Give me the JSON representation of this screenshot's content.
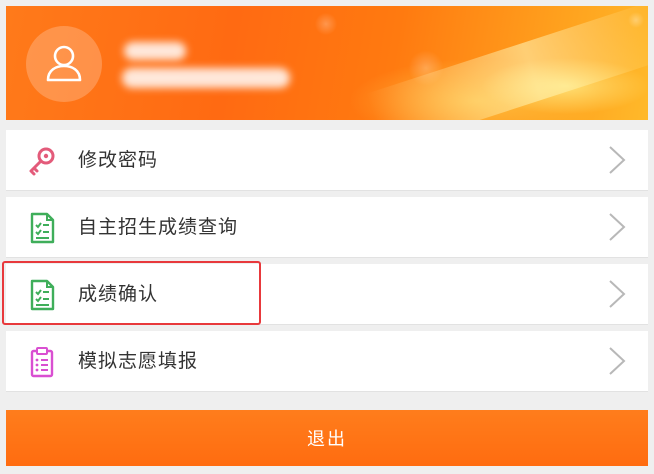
{
  "profile": {
    "avatar_icon": "user-icon",
    "username": ""
  },
  "menu": {
    "items": [
      {
        "label": "修改密码",
        "icon": "key-icon",
        "icon_color": "#e35b7a"
      },
      {
        "label": "自主招生成绩查询",
        "icon": "report-icon",
        "icon_color": "#3fae5a"
      },
      {
        "label": "成绩确认",
        "icon": "report-icon",
        "icon_color": "#3fae5a"
      },
      {
        "label": "模拟志愿填报",
        "icon": "checklist-icon",
        "icon_color": "#d94fd1"
      }
    ]
  },
  "logout": {
    "label": "退出"
  },
  "colors": {
    "accent": "#ff6c10",
    "highlight": "#e8393c"
  }
}
